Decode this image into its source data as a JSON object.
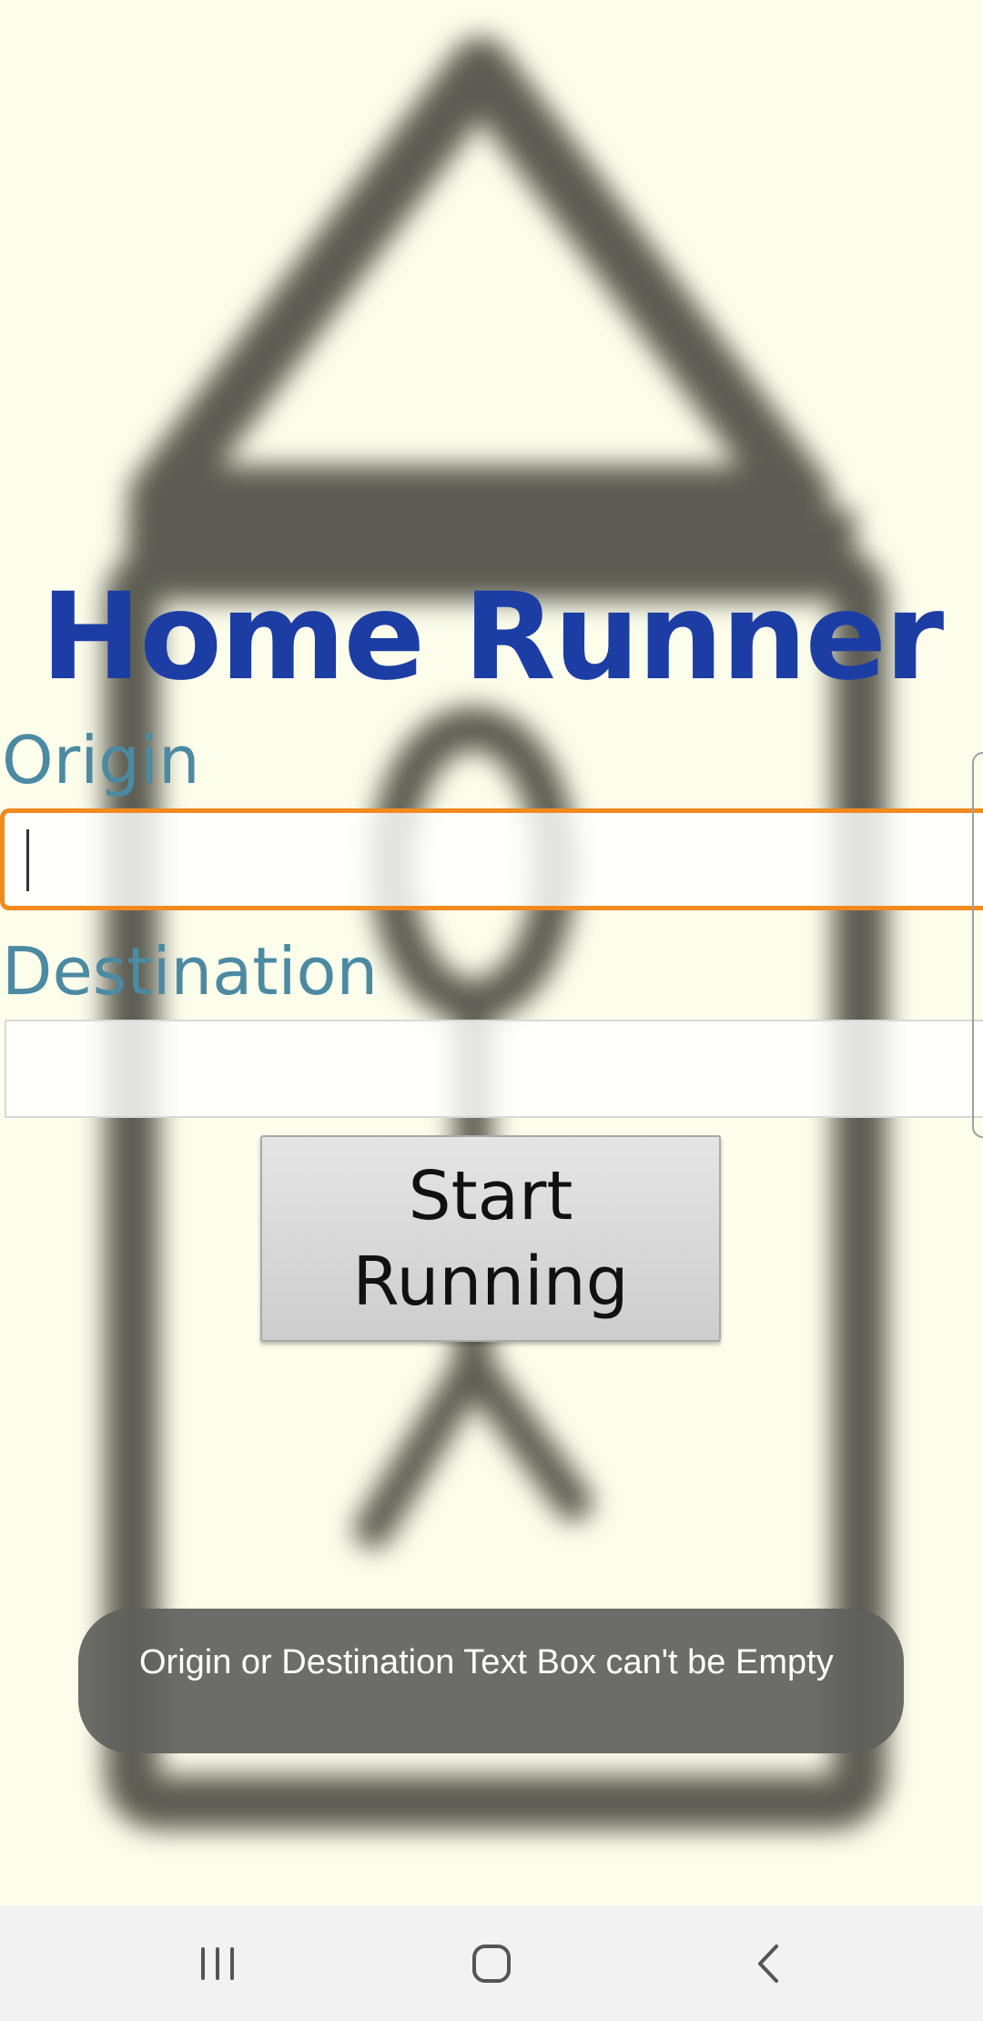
{
  "app": {
    "title": "Home Runner"
  },
  "form": {
    "origin_label": "Origin",
    "origin_value": "",
    "destination_label": "Destination",
    "destination_value": "",
    "start_button_label": "Start Running"
  },
  "toast": {
    "message": "Origin or Destination Text Box can't be Empty"
  },
  "nav_bar": {
    "recents_icon": "recents-icon",
    "home_icon": "home-icon",
    "back_icon": "back-icon"
  },
  "colors": {
    "background": "#fdfdec",
    "title": "#1c3ea4",
    "label": "#4c8aa2",
    "focus_border": "#f28a1c",
    "toast_bg": "#5f5f5c"
  }
}
